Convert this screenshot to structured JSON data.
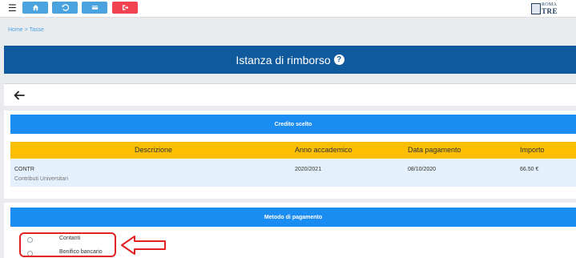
{
  "breadcrumb": {
    "home": "Home",
    "separator": ">",
    "current": "Tasse"
  },
  "toolbar": {
    "menu_icon": "hamburger-icon",
    "buttons": [
      {
        "icon": "home-icon",
        "color": "#4aa3df"
      },
      {
        "icon": "undo-icon",
        "color": "#4aa3df"
      },
      {
        "icon": "card-icon",
        "color": "#4aa3df"
      },
      {
        "icon": "logout-icon",
        "color": "#f0424f"
      }
    ],
    "logo": {
      "line1": "ROMA",
      "line2": "TRE"
    }
  },
  "page": {
    "title": "Istanza di rimborso",
    "help": "?"
  },
  "credit": {
    "header": "Credito scelto",
    "columns": [
      "Descrizione",
      "Anno accademico",
      "Data pagamento",
      "Importo"
    ],
    "rows": [
      {
        "code": "CONTR",
        "description": "Contributi Universitari",
        "year": "2020/2021",
        "date": "08/10/2020",
        "amount": "66.50 €"
      }
    ]
  },
  "payment": {
    "header": "Metodo di pagamento",
    "options": [
      "Contanti",
      "Bonifico bancario"
    ]
  },
  "colors": {
    "primary": "#0f5a9c",
    "header_blue": "#1a8cf2",
    "table_header": "#fbbe00",
    "row_bg": "#e4f0fb",
    "annotation": "#e22222"
  }
}
